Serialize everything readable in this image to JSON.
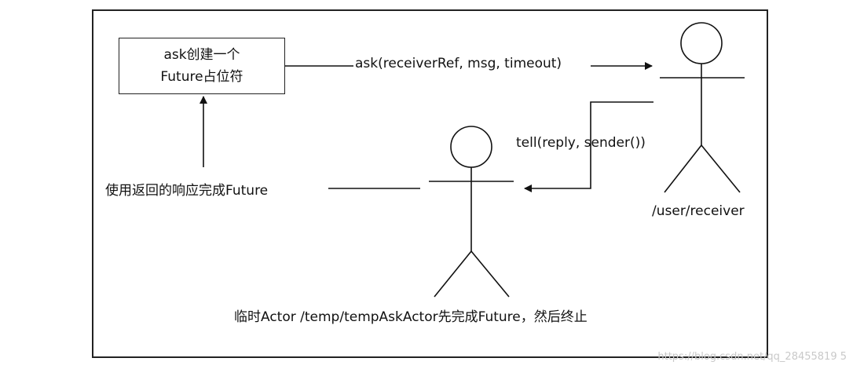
{
  "placeholder_box": {
    "line1": "ask创建一个",
    "line2": "Future占位符"
  },
  "ask_call": "ask(receiverRef, msg, timeout)",
  "tell_call": "tell(reply, sender())",
  "complete_future": "使用返回的响应完成Future",
  "receiver_label": "/user/receiver",
  "temp_actor_label": "临时Actor /temp/tempAskActor先完成Future，然后终止",
  "watermark": "https://blog.csdn.net/qq_28455819 5"
}
